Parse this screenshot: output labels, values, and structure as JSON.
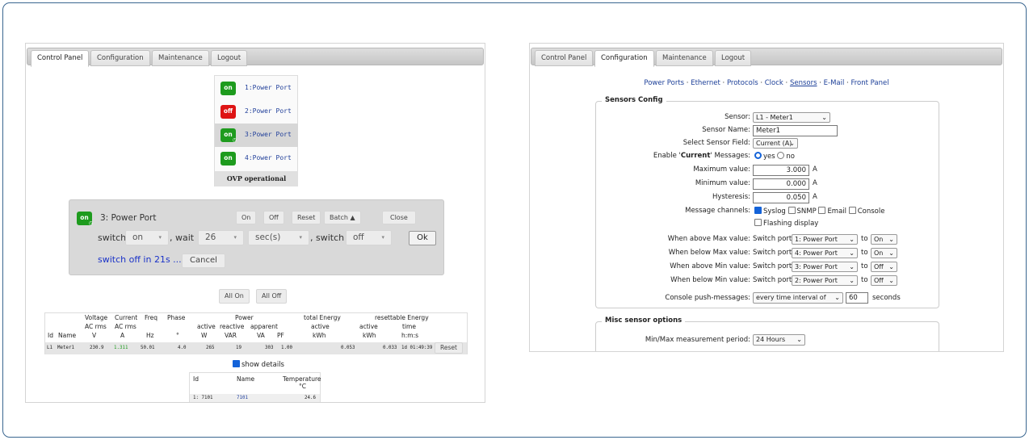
{
  "left": {
    "tabs": [
      "Control Panel",
      "Configuration",
      "Maintenance",
      "Logout"
    ],
    "ports": [
      {
        "state": "on",
        "label": "1:Power Port"
      },
      {
        "state": "off",
        "label": "2:Power Port"
      },
      {
        "state": "on",
        "label": "3:Power Port"
      },
      {
        "state": "on",
        "label": "4:Power Port"
      }
    ],
    "ovp": "OVP operational",
    "dialog": {
      "state": "on",
      "title": "3: Power Port",
      "buttons": [
        "On",
        "Off",
        "Reset",
        "Batch ▲",
        "Close"
      ],
      "switch1": "switch",
      "val1": "on",
      "wait": ", wait",
      "val2": "26",
      "unit": "sec(s)",
      "switch2": ", switch",
      "val3": "off",
      "ok": "Ok",
      "countdown": "switch off in 21s ...",
      "cancel": "Cancel"
    },
    "allon": "All On",
    "alloff": "All Off",
    "meter": {
      "h1": [
        "Voltage",
        "Current",
        "Freq",
        "Phase",
        "Power",
        "total Energy",
        "resettable Energy"
      ],
      "h2": [
        "AC rms",
        "AC rms",
        "active",
        "reactive",
        "apparent",
        "active",
        "active",
        "time"
      ],
      "h3": [
        "Id",
        "Name",
        "V",
        "A",
        "Hz",
        "°",
        "W",
        "VAR",
        "VA",
        "PF",
        "kWh",
        "kWh",
        "h:m:s"
      ],
      "row": [
        "L1",
        "Meter1",
        "230.9",
        "1.311",
        "50.01",
        "4.0",
        "265",
        "19",
        "303",
        "1.00",
        "0.053",
        "0.033",
        "1d 01:49:39"
      ],
      "reset": "Reset"
    },
    "show_details": "show details",
    "temp": {
      "h": [
        "Id",
        "Name",
        "Temperature",
        "°C"
      ],
      "row": [
        "1: 7101",
        "7101",
        "24.6"
      ]
    }
  },
  "right": {
    "tabs": [
      "Control Panel",
      "Configuration",
      "Maintenance",
      "Logout"
    ],
    "nav": [
      "Power Ports",
      "Ethernet",
      "Protocols",
      "Clock",
      "Sensors",
      "E-Mail",
      "Front Panel"
    ],
    "sep": "·",
    "legend": "Sensors Config",
    "sensor_lbl": "Sensor:",
    "sensor_val": "L1 - Meter1",
    "name_lbl": "Sensor Name:",
    "name_val": "Meter1",
    "field_lbl": "Select Sensor Field:",
    "field_val": "Current (A)",
    "enable_pre": "Enable '",
    "enable_b": "Current",
    "enable_post": "' Messages:",
    "yes": "yes",
    "no": "no",
    "max_lbl": "Maximum value:",
    "max_val": "3.000",
    "min_lbl": "Minimum value:",
    "min_val": "0.000",
    "hys_lbl": "Hysteresis:",
    "hys_val": "0.050",
    "unitA": "A",
    "mc_lbl": "Message channels:",
    "mc": [
      "Syslog",
      "SNMP",
      "Email",
      "Console",
      "Flashing display"
    ],
    "when": [
      {
        "lbl": "When above Max value:",
        "port": "1: Power Port",
        "act": "On"
      },
      {
        "lbl": "When below Max value:",
        "port": "4: Power Port",
        "act": "On"
      },
      {
        "lbl": "When above Min value:",
        "port": "3: Power Port",
        "act": "Off"
      },
      {
        "lbl": "When below Min value:",
        "port": "2: Power Port",
        "act": "Off"
      }
    ],
    "switch_port": "Switch port",
    "to": "to",
    "push_lbl": "Console push-messages:",
    "push_val": "every time interval of",
    "push_num": "60",
    "seconds": "seconds",
    "misc_legend": "Misc sensor options",
    "mm_lbl": "Min/Max measurement period:",
    "mm_val": "24 Hours"
  }
}
